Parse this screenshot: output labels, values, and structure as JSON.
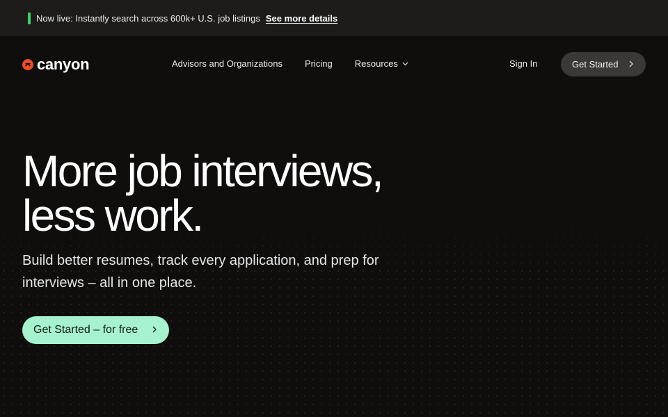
{
  "announcement": {
    "text": "Now live: Instantly search across 600k+ U.S. job listings",
    "link": "See more details",
    "accent_color": "#3fd06a"
  },
  "nav": {
    "logo": {
      "text": "canyon",
      "icon": "canyon-logo-icon",
      "color": "#f04d2a"
    },
    "links": [
      {
        "label": "Advisors and Organizations"
      },
      {
        "label": "Pricing"
      },
      {
        "label": "Resources",
        "icon": "chevron-down-icon"
      }
    ],
    "sign_in": "Sign In",
    "get_started": "Get Started"
  },
  "hero": {
    "title_line1": "More job interviews,",
    "title_line2": "less work.",
    "subtitle": "Build better resumes, track every application, and prep for interviews – all in one place.",
    "cta": "Get Started – for free",
    "cta_color": "#a6f2cf"
  }
}
